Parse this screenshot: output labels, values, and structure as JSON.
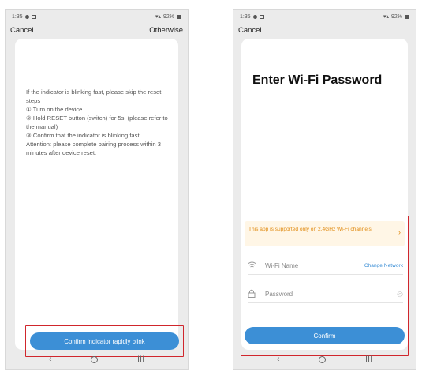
{
  "status_bar": {
    "time": "1:35",
    "battery": "92%"
  },
  "left_screen": {
    "cancel_label": "Cancel",
    "otherwise_label": "Otherwise",
    "instructions": [
      "If the indicator is blinking fast, please skip the reset steps",
      "① Turn on the device",
      "② Hold RESET button (switch) for 5s. (please refer to the manual)",
      "③ Confirm that the indicator is blinking fast",
      "Attention: please complete pairing process within 3 minutes after device reset."
    ],
    "confirm_button": "Confirm indicator rapidly blink"
  },
  "right_screen": {
    "cancel_label": "Cancel",
    "title": "Enter Wi-Fi Password",
    "warning": "This app is supported only on 2.4GHz Wi-Fi channels",
    "wifi_name_label": "Wi-Fi Name",
    "change_network": "Change Network",
    "password_placeholder": "Password",
    "confirm_button": "Confirm"
  },
  "nav": {
    "back": "‹",
    "recents": "III"
  },
  "colors": {
    "accent": "#3c8fd6",
    "highlight": "#d0262c",
    "warning": "#e08a10"
  }
}
